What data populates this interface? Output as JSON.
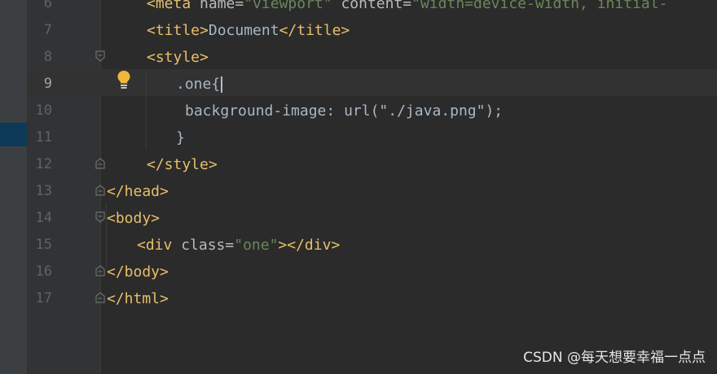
{
  "editor": {
    "active_line": "9",
    "lines": [
      {
        "num": "6",
        "text": "<meta name=\"viewport\" content=\"width=device-width, initial-"
      },
      {
        "num": "7",
        "text": "<title>Document</title>"
      },
      {
        "num": "8",
        "text": "<style>"
      },
      {
        "num": "9",
        "text": ".one{"
      },
      {
        "num": "10",
        "text": "background-image: url(\"./java.png\");"
      },
      {
        "num": "11",
        "text": "}"
      },
      {
        "num": "12",
        "text": "</style>"
      },
      {
        "num": "13",
        "text": "</head>"
      },
      {
        "num": "14",
        "text": "<body>"
      },
      {
        "num": "15",
        "text": "<div class=\"one\"></div>"
      },
      {
        "num": "16",
        "text": "</body>"
      },
      {
        "num": "17",
        "text": "</html>"
      }
    ]
  },
  "icons": {
    "intention": "lightbulb-icon",
    "fold": "fold-marker-icon"
  },
  "colors": {
    "background": "#2b2b2b",
    "tag": "#e8bf6a",
    "string": "#6a8759",
    "text": "#a9b7c6",
    "line_number": "#606366",
    "bulb": "#f0b73b"
  },
  "watermark": "CSDN @每天想要幸福一点点"
}
